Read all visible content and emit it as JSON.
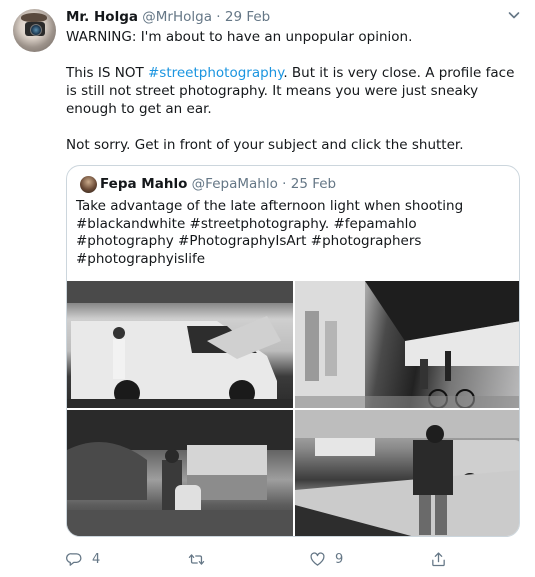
{
  "tweet": {
    "author_name": "Mr. Holga",
    "author_handle": "@MrHolga",
    "separator": "·",
    "date": "29 Feb",
    "line1": "WARNING: I'm about to have an unpopular opinion.",
    "line2_pre": "This IS NOT ",
    "hashtag": "#streetphotography",
    "line2_post": ". But it is very close. A profile face is still not street photography. It means you were just sneaky enough to get an ear.",
    "line3": "Not sorry. Get in front of your subject and click the shutter."
  },
  "quote": {
    "author_name": "Fepa Mahlo",
    "author_handle": "@FepaMahlo",
    "separator": "·",
    "date": "25 Feb",
    "text": "Take advantage of the late afternoon light when shooting #blackandwhite #streetphotography. #fepamahlo #photography #PhotographyIsArt #photographers #photographyislife"
  },
  "actions": {
    "reply_count": "4",
    "like_count": "9"
  },
  "icons": [
    "caret-down-icon",
    "reply-icon",
    "retweet-icon",
    "like-icon",
    "share-icon"
  ],
  "colors": {
    "link": "#1b95e0",
    "muted": "#657786",
    "border": "#ccd6dd"
  }
}
